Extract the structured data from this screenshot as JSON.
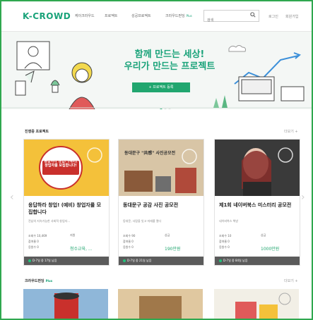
{
  "header": {
    "logo": "K-CROWD",
    "nav": [
      "케이크라우드",
      "프로젝트",
      "성공프로젝트",
      "크라우드펀딩"
    ],
    "nav_badge": "Plus",
    "search": {
      "placeholder": "검색"
    },
    "util": [
      "로그인",
      "회원가입"
    ]
  },
  "hero": {
    "title_line1": "함께 만드는 세상!",
    "title_line2": "우리가 만드는 프로젝트",
    "cta_label": "+ 프로젝트 등록"
  },
  "section1": {
    "title": "진행중 프로젝트",
    "more": "더보기 +"
  },
  "cards": [
    {
      "poster_text": "응답하라 창업! (예비)창업자를 모집합니다!",
      "title": "응답하라 창업! (예비) 창업자를 모집합니다",
      "sub": "전남의 지속가능한 사회적 창업자...",
      "stats": [
        "조회수 10,469",
        "참여율 0",
        "응원수 0"
      ],
      "amount_label": "지원",
      "amount": "청수교육, ...",
      "foot": "D-7일 중 17일 남음"
    },
    {
      "poster_text": "동대문구 \"共感\" 사진공모전",
      "title": "동대문구 공감 사진 공모전",
      "sub": "동대문, 사람을 잇고 미래를 열다",
      "stats": [
        "조회수 90",
        "참여율 0",
        "응원수 0"
      ],
      "amount_label": "상금",
      "amount": "190만원",
      "foot": "D-7일 중 21일 남음"
    },
    {
      "poster_text": "",
      "title": "제1회 네이버북스 미스터리 공모전",
      "sub": "네이버북스 책방",
      "stats": [
        "조회수 10",
        "참여율 0",
        "응원수 0"
      ],
      "amount_label": "상금",
      "amount": "1000만원",
      "foot": "D-7일 중 84일 남음"
    }
  ],
  "section2": {
    "title": "크라우드펀딩",
    "badge": "Plus",
    "more": "더보기 +"
  },
  "colors": {
    "accent": "#21a66f",
    "frame": "#2fa84f",
    "poster_yellow": "#f4c13a"
  },
  "icons": [
    "search-icon",
    "chevron-left-icon",
    "chevron-right-icon",
    "bookmark-icon"
  ]
}
